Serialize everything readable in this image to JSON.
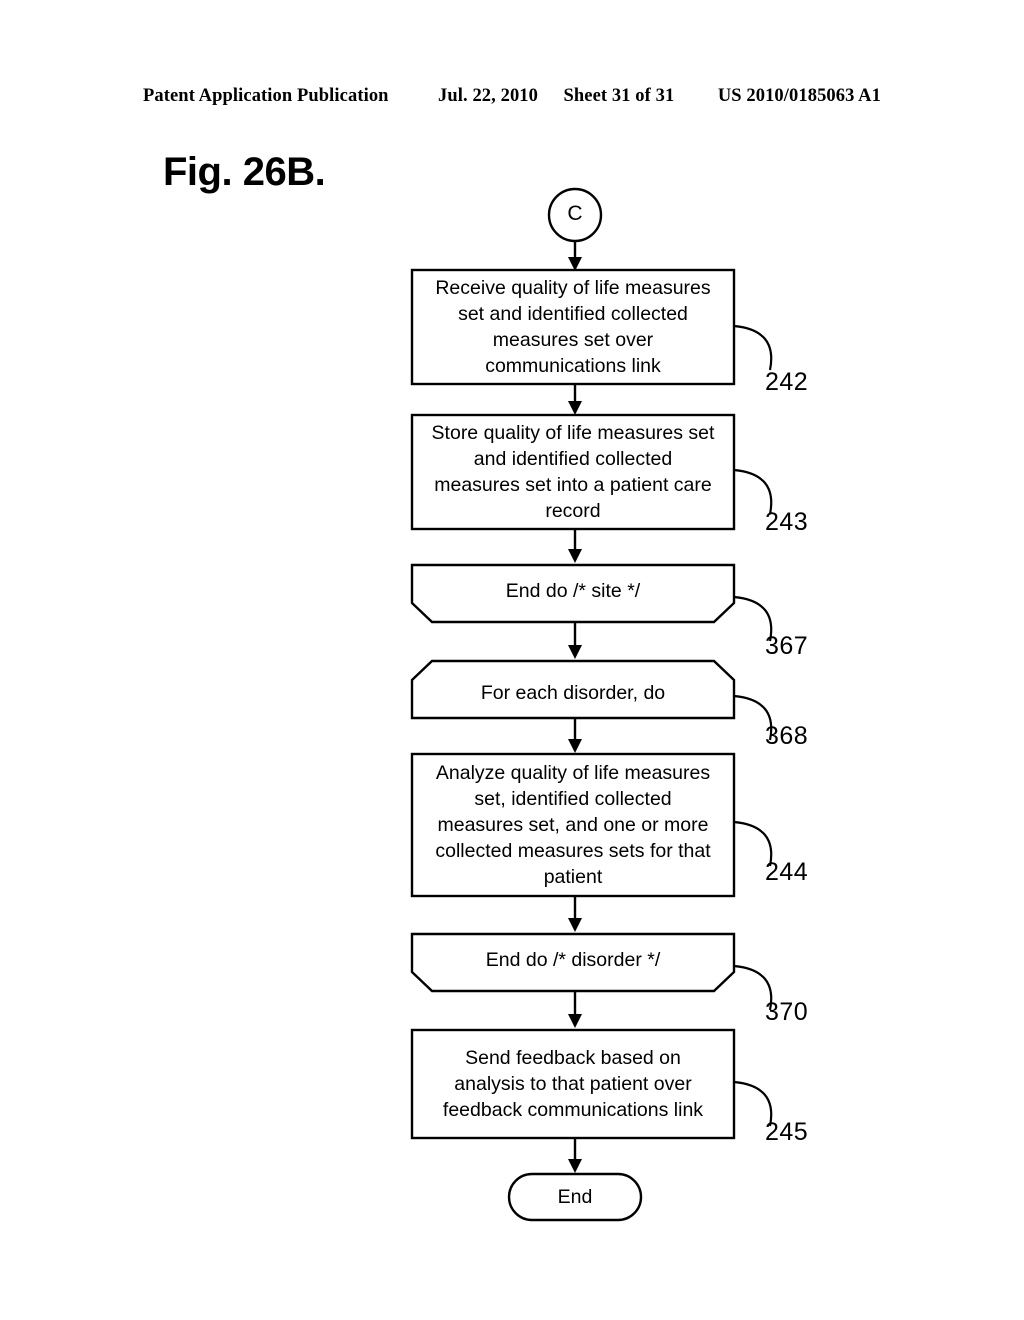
{
  "header": {
    "publication": "Patent Application Publication",
    "date": "Jul. 22, 2010",
    "sheet": "Sheet 31 of 31",
    "patent_number": "US 2010/0185063 A1"
  },
  "figure": {
    "title": "Fig. 26B."
  },
  "flowchart": {
    "connector_in": {
      "label": "C",
      "shape": "circle"
    },
    "nodes": [
      {
        "id": "node-242",
        "shape": "process",
        "text": "Receive quality of life measures\nset and identified collected\nmeasures set over\ncommunications link",
        "ref": "242"
      },
      {
        "id": "node-243",
        "shape": "process",
        "text": "Store quality of life measures set\nand identified collected\nmeasures set into a patient care\nrecord",
        "ref": "243"
      },
      {
        "id": "node-367",
        "shape": "loop-end",
        "text": "End do  /* site */",
        "ref": "367"
      },
      {
        "id": "node-368",
        "shape": "loop-start",
        "text": "For each disorder, do",
        "ref": "368"
      },
      {
        "id": "node-244",
        "shape": "process",
        "text": "Analyze quality of life measures\nset, identified collected\nmeasures set, and one or more\ncollected measures sets for that\npatient",
        "ref": "244"
      },
      {
        "id": "node-370",
        "shape": "loop-end",
        "text": "End do  /* disorder */",
        "ref": "370"
      },
      {
        "id": "node-245",
        "shape": "process",
        "text": "Send feedback based on\nanalysis to that patient over\nfeedback communications link",
        "ref": "245"
      }
    ],
    "terminator": {
      "label": "End",
      "shape": "stadium"
    },
    "colors": {
      "stroke": "#000000",
      "fill": "#ffffff",
      "text": "#000000"
    }
  }
}
